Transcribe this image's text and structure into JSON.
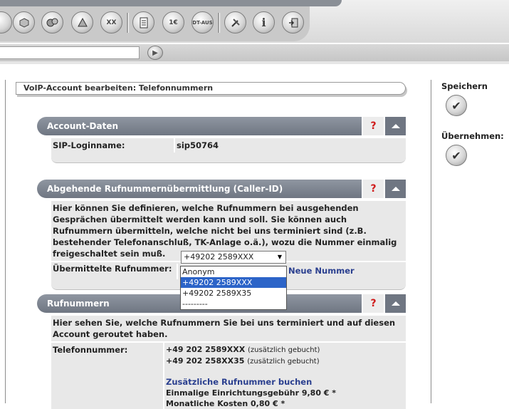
{
  "toolbar": {
    "buttons": [
      {
        "icon": "circle-icon"
      },
      {
        "icon": "cube-icon"
      },
      {
        "icon": "cubes-icon"
      },
      {
        "icon": "pyramid-icon"
      },
      {
        "icon": "car-xx-icon",
        "label": "XX"
      },
      {
        "icon": "document-list-icon"
      },
      {
        "icon": "document-euro-icon",
        "label": "1€"
      },
      {
        "icon": "dt-aus-icon",
        "label": "DT-AUS"
      },
      {
        "icon": "tools-icon"
      },
      {
        "icon": "info-icon",
        "label": "i"
      },
      {
        "icon": "logout-icon"
      }
    ]
  },
  "search": {
    "value": "",
    "go_icon": "play-icon"
  },
  "page": {
    "title": "VoIP-Account bearbeiten: Telefonnummern"
  },
  "side": {
    "save_label": "Speichern",
    "apply_label": "Übernehmen:"
  },
  "sections": {
    "account": {
      "title": "Account-Daten",
      "help": "?",
      "sip_key": "SIP-Loginname:",
      "sip_value": "sip50764"
    },
    "callerid": {
      "title": "Abgehende Rufnummernübermittlung (Caller-ID)",
      "help": "?",
      "description": "Hier können Sie definieren, welche Rufnummern bei ausgehenden Gesprächen übermittelt werden kann und soll. Sie können auch Rufnummern übermitteln, welche nicht bei uns terminiert sind (z.B. bestehender Telefonanschluß, TK-Anlage o.ä.), wozu die Nummer einmalig freigeschaltet sein muß.",
      "number_label": "Übermittelte Rufnummer:",
      "selected": "+49202 2589XXX",
      "new_number_link": "Neue Nummer",
      "options": [
        "Anonym",
        "+49202 2589XXX",
        "+49202 2589X35",
        "---------"
      ],
      "selected_index": 1
    },
    "numbers": {
      "title": "Rufnummern",
      "help": "?",
      "description": "Hier sehen Sie, welche Rufnummern Sie bei uns terminiert und auf diesen Account geroutet haben.",
      "phone_label": "Telefonnummer:",
      "phones": [
        {
          "number": "+49 202 2589XXX",
          "note": "(zusätzlich gebucht)"
        },
        {
          "number": "+49 202 258XX35",
          "note": "(zusätzlich gebucht)"
        }
      ],
      "book_link": "Zusätzliche Rufnummer buchen",
      "setup_fee": "Einmalige Einrichtungsgebühr 9,80 € *",
      "monthly_fee": "Monatliche Kosten 0,80 € *"
    }
  }
}
